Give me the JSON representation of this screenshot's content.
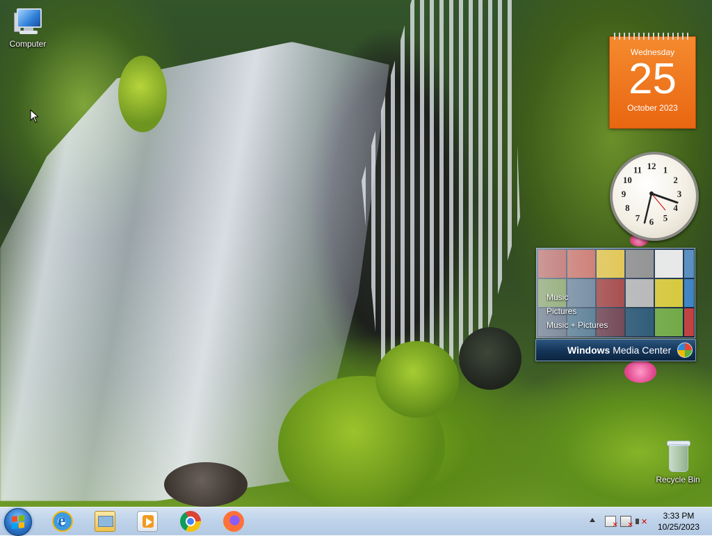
{
  "desktop": {
    "icons": [
      {
        "label": "Computer"
      },
      {
        "label": "Recycle Bin"
      }
    ]
  },
  "gadgets": {
    "calendar": {
      "weekday": "Wednesday",
      "day": "25",
      "month_year": "October 2023"
    },
    "clock": {
      "time": "3:33 PM",
      "numerals": [
        "12",
        "1",
        "2",
        "3",
        "4",
        "5",
        "6",
        "7",
        "8",
        "9",
        "10",
        "11"
      ]
    },
    "media_center": {
      "menu": [
        "Music",
        "Pictures",
        "Music + Pictures"
      ],
      "brand_bold": "Windows",
      "brand_rest": "Media Center"
    }
  },
  "taskbar": {
    "pinned": [
      {
        "name": "Start",
        "icon": "windows-logo-icon"
      },
      {
        "name": "Internet Explorer",
        "icon": "internet-explorer-icon"
      },
      {
        "name": "Windows Explorer",
        "icon": "folder-icon"
      },
      {
        "name": "Windows Media Player",
        "icon": "media-player-icon"
      },
      {
        "name": "Google Chrome",
        "icon": "chrome-icon"
      },
      {
        "name": "Firefox",
        "icon": "firefox-icon"
      }
    ],
    "tray": {
      "time": "3:33 PM",
      "date": "10/25/2023"
    }
  },
  "colors": {
    "calendar_orange": "#e96611",
    "taskbar_blue": "#bfd3ea"
  }
}
